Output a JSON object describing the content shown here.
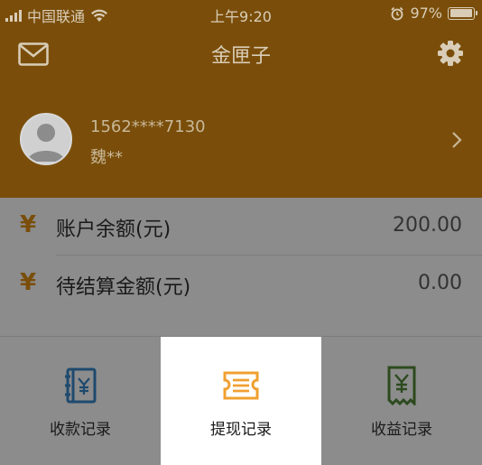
{
  "status_bar": {
    "carrier": "中国联通",
    "time": "上午9:20",
    "battery": "97%",
    "battery_level": 0.97
  },
  "header": {
    "title": "金匣子",
    "left_icon": "mail-icon",
    "right_icon": "gear-icon"
  },
  "profile": {
    "phone": "1562****7130",
    "name": "魏**"
  },
  "balances": [
    {
      "symbol": "¥",
      "label": "账户余额(元)",
      "value": "200.00"
    },
    {
      "symbol": "¥",
      "label": "待结算金额(元)",
      "value": "0.00"
    }
  ],
  "menu": [
    {
      "label": "收款记录",
      "icon": "receipt-book-icon",
      "active": false,
      "color": "#1e4a6e"
    },
    {
      "label": "提现记录",
      "icon": "ticket-icon",
      "active": true,
      "color": "#f0a030"
    },
    {
      "label": "收益记录",
      "icon": "earnings-receipt-icon",
      "active": false,
      "color": "#2d4a1e"
    }
  ],
  "colors": {
    "brand": "#7a4e0a",
    "background": "#8c8c8c",
    "active_tile": "#ffffff"
  }
}
